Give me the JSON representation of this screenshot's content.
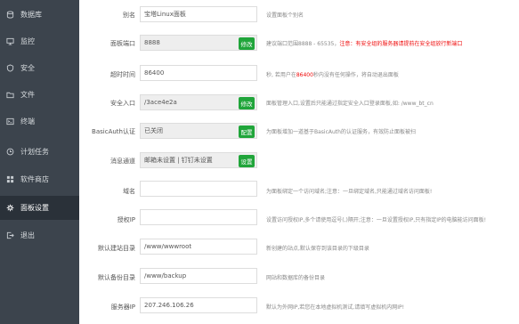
{
  "sidebar": {
    "items": [
      {
        "label": "数据库"
      },
      {
        "label": "监控"
      },
      {
        "label": "安全"
      },
      {
        "label": "文件"
      },
      {
        "label": "终端"
      },
      {
        "label": "计划任务"
      },
      {
        "label": "软件商店"
      },
      {
        "label": "面板设置"
      },
      {
        "label": "退出"
      }
    ]
  },
  "settings": {
    "alias": {
      "label": "别名",
      "value": "宝塔Linux面板",
      "help": "设置面板个别名"
    },
    "port": {
      "label": "面板端口",
      "value": "8888",
      "button": "修改",
      "help_prefix": "建议端口范围8888 - 65535，",
      "help_warning": "注意：有安全组的服务器请提前在安全组放行新端口"
    },
    "timeout": {
      "label": "超时时间",
      "value": "86400",
      "help_prefix": "秒, 若用户在",
      "help_highlight": "86400",
      "help_suffix": "秒内没有任何操作，将自动退出面板"
    },
    "entry": {
      "label": "安全入口",
      "value": "/3ace4e2a",
      "button": "修改",
      "help": "面板管理入口,设置后只能通过指定安全入口登录面板,如: /www_bt_cn"
    },
    "basic_auth": {
      "label": "BasicAuth认证",
      "value": "已关闭",
      "button": "配置",
      "help": "为面板增加一道基于BasicAuth的认证服务，有效防止面板被扫"
    },
    "notify": {
      "label": "消息通道",
      "value": "邮箱未设置 | 钉钉未设置",
      "button": "设置"
    },
    "domain": {
      "label": "域名",
      "value": "",
      "help": "为面板绑定一个访问域名;注意：一旦绑定域名,只能通过域名访问面板!"
    },
    "auth_ip": {
      "label": "授权IP",
      "value": "",
      "help": "设置访问授权IP,多个请使用逗号(,)隔开;注意：一旦设置授权IP,只有指定IP的电脑能访问面板!"
    },
    "site_dir": {
      "label": "默认建站目录",
      "value": "/www/wwwroot",
      "help": "新创建的站点,默认保存到该目录的下级目录"
    },
    "backup_dir": {
      "label": "默认备份目录",
      "value": "/www/backup",
      "help": "网站和数据库的备份目录"
    },
    "server_ip": {
      "label": "服务器IP",
      "value": "207.246.106.26",
      "help": "默认为外网IP,若您在本地虚拟机测试,请填写虚拟机内网IP!"
    }
  },
  "colors": {
    "sidebar_bg": "#3c444d",
    "active_bg": "#2a3139",
    "accent": "#20a53a",
    "warning": "#ef0808"
  }
}
